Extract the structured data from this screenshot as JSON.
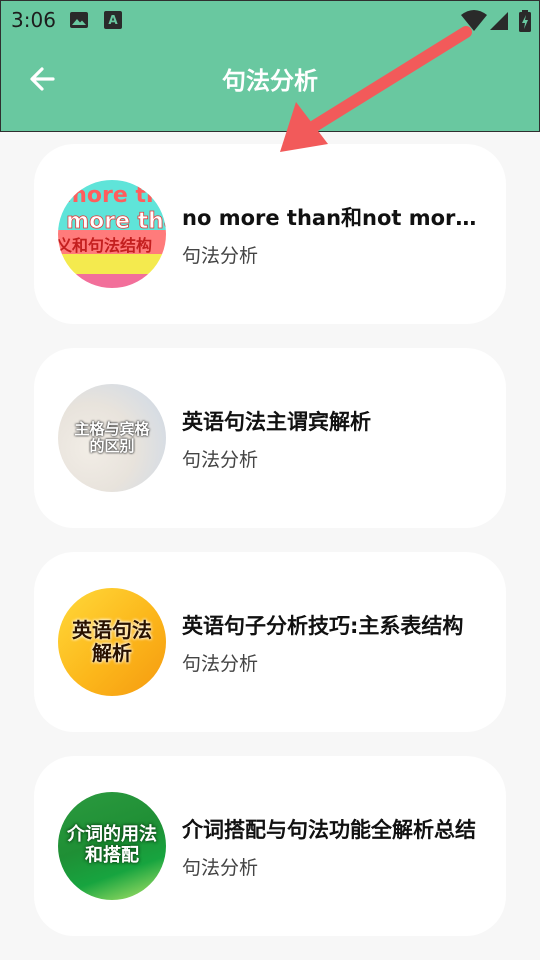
{
  "status_bar": {
    "time": "3:06",
    "icons": [
      "image-icon",
      "text-badge-icon",
      "wifi-icon",
      "signal-icon",
      "battery-icon"
    ],
    "badge_letter": "A"
  },
  "appbar": {
    "title": "句法分析",
    "back_icon": "back-arrow-icon"
  },
  "colors": {
    "header_bg": "#69c8a0",
    "annotation_arrow": "#f25a5a",
    "card_bg": "#ffffff",
    "page_bg": "#f7f7f7"
  },
  "items": [
    {
      "title": "no more than和not more than的区别",
      "subtitle": "句法分析",
      "thumb_lines": [
        "more th",
        "t more tha",
        "义和句法结构"
      ]
    },
    {
      "title": "英语句法主谓宾解析",
      "subtitle": "句法分析",
      "thumb_lines": [
        "主格与宾格",
        "的区别"
      ]
    },
    {
      "title": "英语句子分析技巧:主系表结构",
      "subtitle": "句法分析",
      "thumb_lines": [
        "英语句法",
        "解析"
      ]
    },
    {
      "title": "介词搭配与句法功能全解析总结",
      "subtitle": "句法分析",
      "thumb_lines": [
        "介词的用法",
        "和搭配"
      ]
    }
  ]
}
